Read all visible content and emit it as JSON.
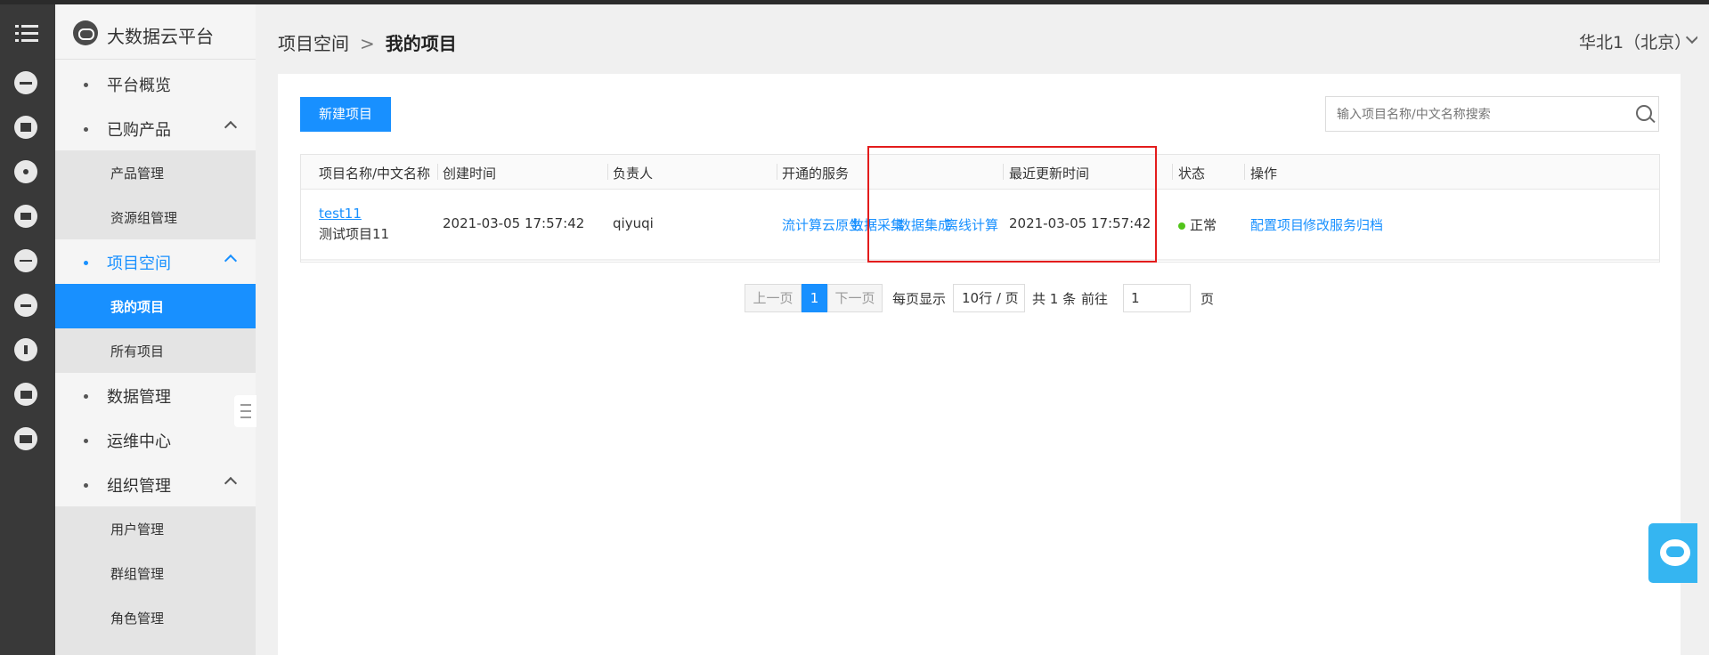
{
  "app": {
    "title": "大数据云平台"
  },
  "rail": {
    "icons": [
      "menu-icon",
      "server-icon",
      "apps-icon",
      "network-icon",
      "cube-icon",
      "database-icon",
      "layers-icon",
      "cloud-upload-icon",
      "mail-icon",
      "id-card-icon"
    ]
  },
  "sidebar": {
    "overview": "平台概览",
    "purchased": "已购产品",
    "product_mgmt": "产品管理",
    "resource_group_mgmt": "资源组管理",
    "project_space": "项目空间",
    "my_projects": "我的项目",
    "all_projects": "所有项目",
    "data_mgmt": "数据管理",
    "ops_center": "运维中心",
    "org_mgmt": "组织管理",
    "user_mgmt": "用户管理",
    "group_mgmt": "群组管理",
    "role_mgmt": "角色管理"
  },
  "header": {
    "breadcrumb_parent": "项目空间",
    "breadcrumb_sep": ">",
    "breadcrumb_current": "我的项目",
    "region": "华北1（北京）"
  },
  "toolbar": {
    "new_project": "新建项目",
    "search_placeholder": "输入项目名称/中文名称搜索"
  },
  "table": {
    "columns": [
      "项目名称/中文名称",
      "创建时间",
      "负责人",
      "开通的服务",
      "最近更新时间",
      "状态",
      "操作"
    ],
    "rows": [
      {
        "name": "test11",
        "cn_name": "测试项目11",
        "created": "2021-03-05 17:57:42",
        "owner": "qiyuqi",
        "services": [
          "流计算云原生",
          "数据采集",
          "数据集成",
          "离线计算"
        ],
        "updated": "2021-03-05 17:57:42",
        "status": "正常",
        "actions": [
          "配置项目",
          "修改服务",
          "归档"
        ]
      }
    ]
  },
  "pagination": {
    "prev": "上一页",
    "current_page": "1",
    "next": "下一页",
    "per_page_label": "每页显示",
    "per_page_value": "10行 / 页",
    "total": "共 1 条",
    "goto_label": "前往",
    "goto_value": "1",
    "page_suffix": "页"
  },
  "colors": {
    "primary": "#1890ff",
    "rail_bg": "#393939",
    "status_ok": "#52c41a",
    "highlight": "#e31c1c",
    "help_bg": "#35b5f1"
  }
}
